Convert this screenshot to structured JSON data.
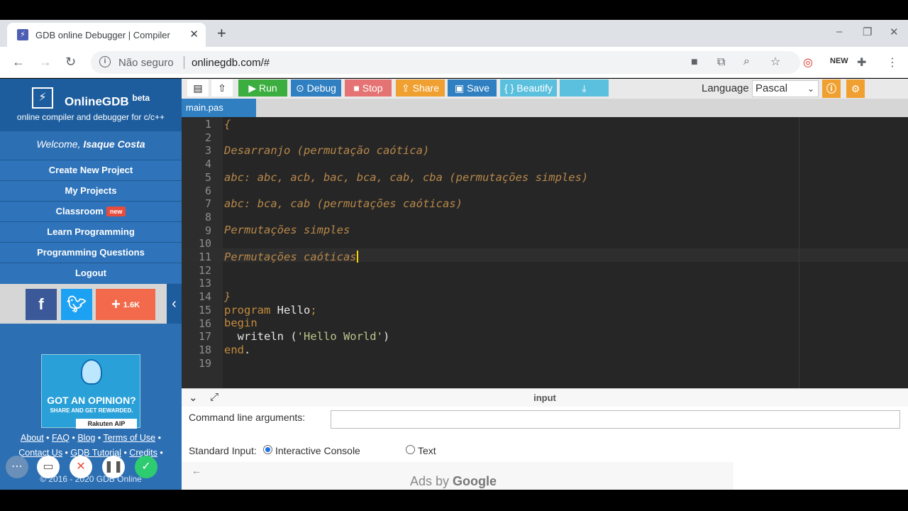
{
  "browser": {
    "tab_title": "GDB online Debugger | Compiler",
    "tab_close": "✕",
    "new_tab": "+",
    "window_controls": [
      "–",
      "❐",
      "✕"
    ],
    "insecure_label": "Não seguro",
    "url": "onlinegdb.com/#",
    "toolbar_icons": [
      "camera-icon",
      "translate-icon",
      "zoom-icon",
      "star-icon",
      "extension-color-icon",
      "new-icon",
      "puzzle-icon",
      "menu-icon"
    ]
  },
  "sidebar": {
    "brand": "OnlineGDB",
    "brand_sup": "beta",
    "tagline": "online compiler and debugger for c/c++",
    "welcome_prefix": "Welcome, ",
    "welcome_user": "Isaque Costa",
    "menu": [
      {
        "label": "Create New Project"
      },
      {
        "label": "My Projects"
      },
      {
        "label": "Classroom",
        "badge": "new"
      },
      {
        "label": "Learn Programming"
      },
      {
        "label": "Programming Questions"
      },
      {
        "label": "Logout"
      }
    ],
    "share_count": "1.6K",
    "ad": {
      "headline": "GOT AN OPINION?",
      "subline": "SHARE AND GET REWARDED.",
      "brand": "Rakuten AIP"
    },
    "footer": {
      "links_row1": [
        "About",
        "FAQ",
        "Blog",
        "Terms of Use"
      ],
      "links_row2": [
        "Contact Us",
        "GDB Tutorial",
        "Credits"
      ],
      "copyright": "© 2016 - 2020 GDB Online"
    }
  },
  "toolbar": {
    "run": "Run",
    "debug": "Debug",
    "stop": "Stop",
    "share": "Share",
    "save": "Save",
    "beautify": "{ } Beautify",
    "language_label": "Language",
    "language_value": "Pascal"
  },
  "editor": {
    "file_tab": "main.pas",
    "line_numbers": [
      "1",
      "2",
      "3",
      "4",
      "5",
      "6",
      "7",
      "8",
      "9",
      "10",
      "11",
      "12",
      "13",
      "14",
      "15",
      "16",
      "17",
      "18",
      "19"
    ],
    "lines": {
      "l1": "{",
      "l3": "Desarranjo (permutação caótica)",
      "l5": "abc: abc, acb, bac, bca, cab, cba (permutações simples)",
      "l7": "abc: bca, cab (permutações caóticas)",
      "l9": "Permutações simples",
      "l11": "Permutações caóticas",
      "l14": "}",
      "l15_kw": "program",
      "l15_id": " Hello",
      "l15_end": ";",
      "l16": "begin",
      "l17_id": "  writeln (",
      "l17_str": "'Hello World'",
      "l17_end": ")",
      "l18_kw": "end",
      "l18_dot": "."
    }
  },
  "io": {
    "panel_label": "input",
    "cmd_label": "Command line arguments:",
    "cmd_value": "",
    "stdin_label": "Standard Input:",
    "opt_interactive": "Interactive Console",
    "opt_text": "Text",
    "ads_prefix": "Ads by",
    "ads_brand": "Google"
  }
}
